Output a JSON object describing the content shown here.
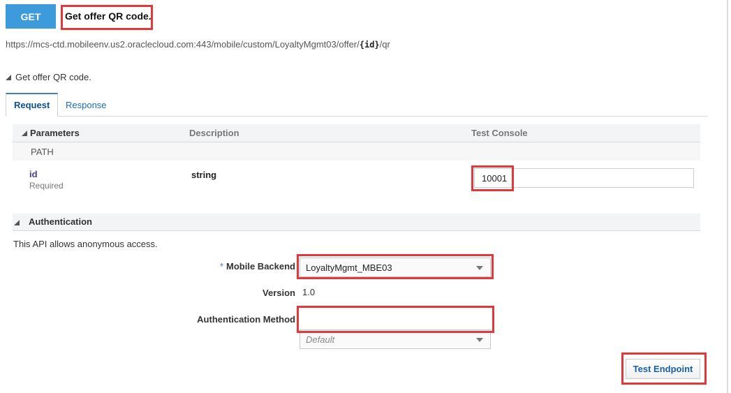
{
  "header": {
    "method_label": "GET",
    "summary": "Get offer QR code.",
    "url_prefix": "https://mcs-ctd.mobileenv.us2.oraclecloud.com:443/mobile/custom/LoyaltyMgmt03/offer/",
    "url_param": "{id}",
    "url_suffix": "/qr"
  },
  "description": {
    "text": "Get offer QR code."
  },
  "tabs": [
    {
      "label": "Request",
      "active": true
    },
    {
      "label": "Response",
      "active": false
    }
  ],
  "parameters": {
    "columns": [
      "Parameters",
      "Description",
      "Test Console"
    ],
    "group_label": "PATH",
    "rows": [
      {
        "name": "id",
        "required_label": "Required",
        "type": "string",
        "value": "10001"
      }
    ]
  },
  "authentication": {
    "title": "Authentication",
    "note": "This API allows anonymous access.",
    "mobile_backend_label": "Mobile Backend",
    "required_marker": "*",
    "mobile_backend_value": "LoyaltyMgmt_MBE03",
    "version_label": "Version",
    "version_value": "1.0",
    "auth_method_label": "Authentication Method",
    "auth_method_value": "Default"
  },
  "actions": {
    "test_endpoint_label": "Test Endpoint"
  },
  "colors": {
    "accent": "#3d9bdc",
    "highlight": "#e3383b",
    "link": "#1a6fb5"
  }
}
